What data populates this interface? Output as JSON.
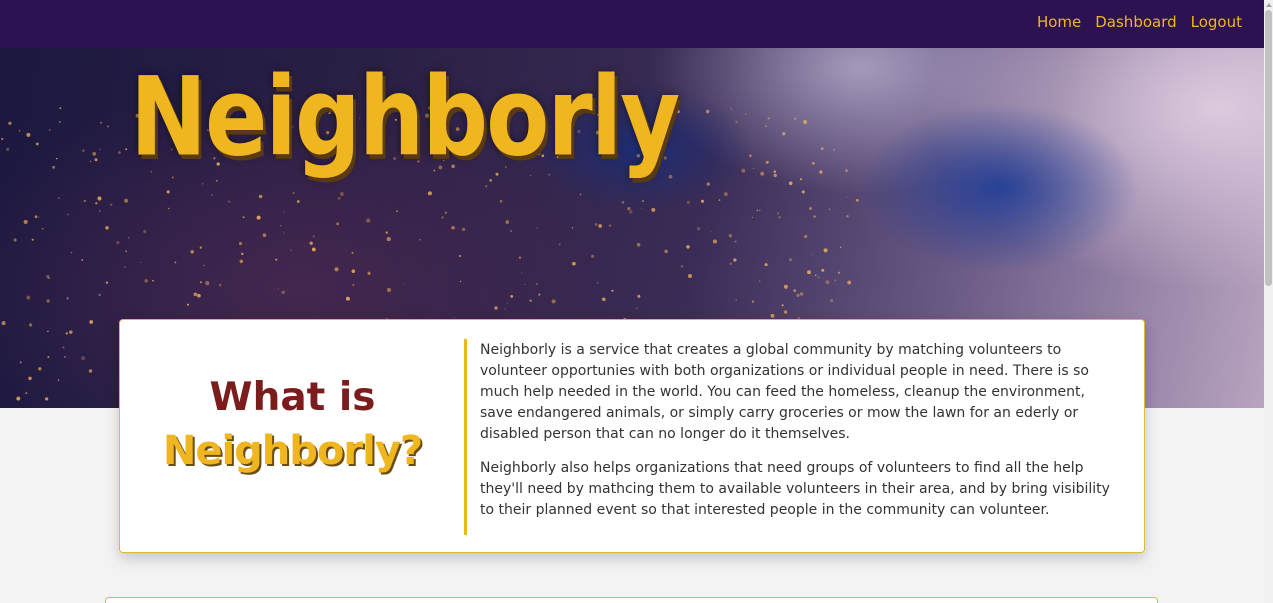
{
  "navbar": {
    "links": [
      {
        "label": "Home"
      },
      {
        "label": "Dashboard"
      },
      {
        "label": "Logout"
      }
    ]
  },
  "hero": {
    "title": "Neighborly"
  },
  "about": {
    "heading_line1": "What is",
    "heading_line2": "Neighborly?",
    "paragraphs": [
      "Neighborly is a service that creates a global community by matching volunteers to volunteer opportunies with both organizations or individual people in need. There is so much help needed in the world. You can feed the homeless, cleanup the environment, save endangered animals, or simply carry groceries or mow the lawn for an ederly or disabled person that can no longer do it themselves.",
      "Neighborly also helps organizations that need groups of volunteers to find all the help they'll need by mathcing them to available volunteers in their area, and by bring visibility to their planned event so that interested people in the community can volunteer."
    ]
  },
  "colors": {
    "navbar_bg": "#2c1250",
    "accent_gold": "#f0b61f",
    "heading_maroon": "#7b1d1d"
  }
}
